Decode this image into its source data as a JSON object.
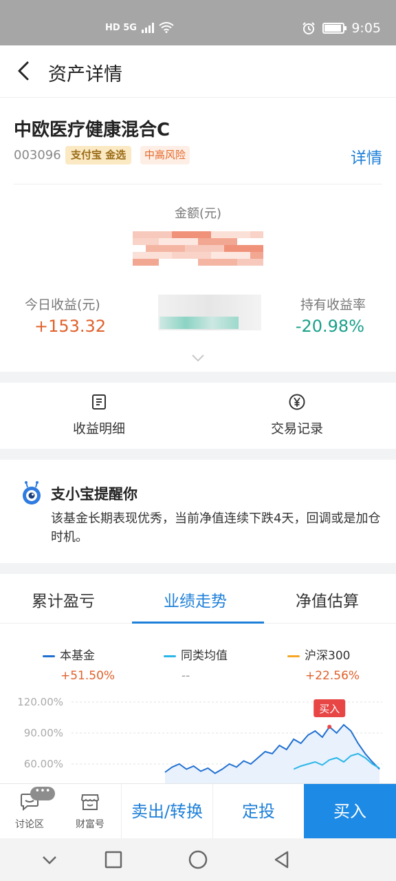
{
  "status_bar": {
    "network": "HD 5G",
    "time": "9:05",
    "battery_level": 0.9
  },
  "header": {
    "title": "资产详情"
  },
  "fund": {
    "name": "中欧医疗健康混合C",
    "code": "003096",
    "tag_platform": "支付宝 金选",
    "tag_risk": "中高风险",
    "detail_link": "详情"
  },
  "summary": {
    "amount_label": "金额(元)",
    "today_label": "今日收益(元)",
    "today_value": "+153.32",
    "rate_label": "持有收益率",
    "rate_value": "-20.98%"
  },
  "actions": [
    {
      "label": "收益明细",
      "icon": "document-icon"
    },
    {
      "label": "交易记录",
      "icon": "yen-circle-icon"
    }
  ],
  "reminder": {
    "title": "支小宝提醒你",
    "text": "该基金长期表现优秀，当前净值连续下跌4天，回调或是加仓时机。"
  },
  "chart_tabs": {
    "tab1": "累计盈亏",
    "tab2": "业绩走势",
    "tab3": "净值估算"
  },
  "chart_data": {
    "type": "line",
    "legend": [
      {
        "name": "本基金",
        "value": "+51.50%",
        "color": "#1f6fd1"
      },
      {
        "name": "同类均值",
        "value": "--",
        "color": "#29b6e8"
      },
      {
        "name": "沪深300",
        "value": "+22.56%",
        "color": "#f5a623"
      }
    ],
    "y_ticks": [
      "120.00%",
      "90.00%",
      "60.00%"
    ],
    "annotation": "买入",
    "series": [
      {
        "name": "本基金",
        "values": [
          52,
          57,
          60,
          55,
          58,
          53,
          56,
          51,
          55,
          60,
          57,
          63,
          60,
          66,
          72,
          70,
          78,
          74,
          84,
          80,
          88,
          92,
          86,
          96,
          90,
          98,
          92,
          80,
          70,
          62,
          55
        ]
      },
      {
        "name": "同类均值",
        "values": [
          null,
          null,
          null,
          null,
          null,
          null,
          null,
          null,
          null,
          null,
          null,
          null,
          null,
          null,
          null,
          null,
          null,
          null,
          55,
          58,
          60,
          62,
          59,
          64,
          66,
          62,
          68,
          70,
          66,
          60,
          56
        ]
      }
    ]
  },
  "bottom_bar": {
    "forum": "讨论区",
    "wealth": "财富号",
    "badge": "•••",
    "sell": "卖出/转换",
    "plan": "定投",
    "buy": "买入"
  },
  "colors": {
    "accent": "#1d7fd8",
    "positive": "#e0602a",
    "negative": "#1aa089"
  }
}
